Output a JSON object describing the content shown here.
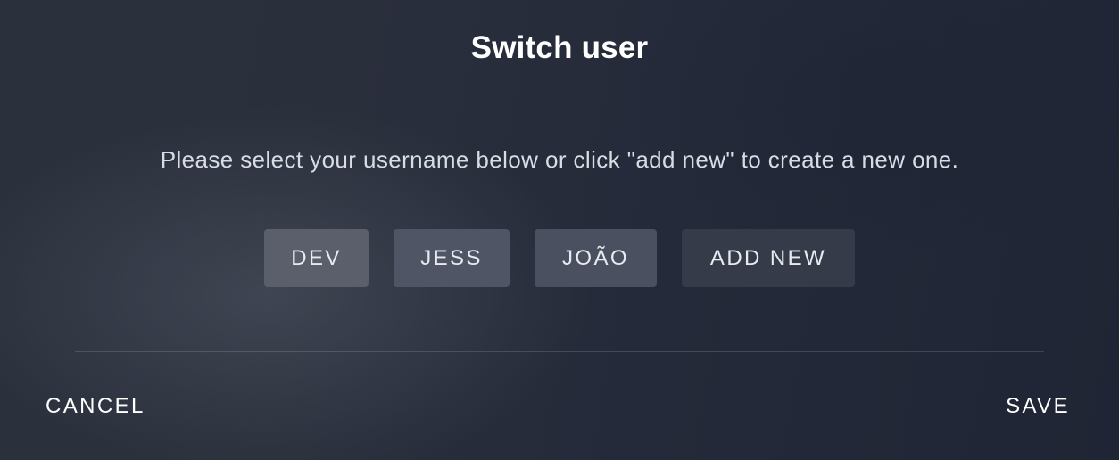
{
  "dialog": {
    "title": "Switch user",
    "message": "Please select your username below or click \"add new\" to create a new one.",
    "users": [
      {
        "label": "DEV"
      },
      {
        "label": "JESS"
      },
      {
        "label": "JOÃO"
      }
    ],
    "add_new_label": "ADD NEW",
    "cancel_label": "CANCEL",
    "save_label": "SAVE"
  }
}
